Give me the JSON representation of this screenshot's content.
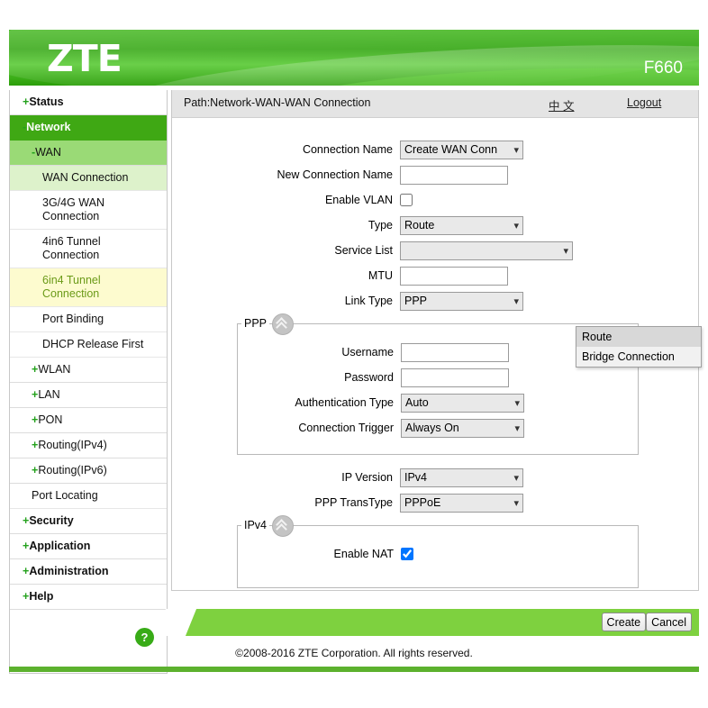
{
  "header": {
    "brand": "ZTE",
    "model": "F660"
  },
  "pathbar": {
    "path": "Path:Network-WAN-WAN Connection",
    "language_label": "中 文",
    "logout_label": "Logout"
  },
  "sidebar": {
    "items": [
      {
        "label": "Status",
        "prefix": "+",
        "level": "top",
        "state": "normal"
      },
      {
        "label": "Network",
        "prefix": "-",
        "level": "top",
        "state": "active"
      },
      {
        "label": "WAN",
        "prefix": "-",
        "level": "sub",
        "state": "open"
      },
      {
        "label": "WAN Connection",
        "prefix": "",
        "level": "leaf",
        "state": "selected"
      },
      {
        "label": "3G/4G WAN Connection",
        "prefix": "",
        "level": "leaf",
        "state": "normal"
      },
      {
        "label": "4in6 Tunnel Connection",
        "prefix": "",
        "level": "leaf",
        "state": "normal"
      },
      {
        "label": "6in4 Tunnel Connection",
        "prefix": "",
        "level": "leaf",
        "state": "hovered"
      },
      {
        "label": "Port Binding",
        "prefix": "",
        "level": "leaf",
        "state": "normal"
      },
      {
        "label": "DHCP Release First",
        "prefix": "",
        "level": "leaf",
        "state": "normal"
      },
      {
        "label": "WLAN",
        "prefix": "+",
        "level": "sub",
        "state": "normal"
      },
      {
        "label": "LAN",
        "prefix": "+",
        "level": "sub",
        "state": "normal"
      },
      {
        "label": "PON",
        "prefix": "+",
        "level": "sub",
        "state": "normal"
      },
      {
        "label": "Routing(IPv4)",
        "prefix": "+",
        "level": "sub",
        "state": "normal"
      },
      {
        "label": "Routing(IPv6)",
        "prefix": "+",
        "level": "sub",
        "state": "normal"
      },
      {
        "label": "Port Locating",
        "prefix": "",
        "level": "sub-plain",
        "state": "normal"
      },
      {
        "label": "Security",
        "prefix": "+",
        "level": "top",
        "state": "normal"
      },
      {
        "label": "Application",
        "prefix": "+",
        "level": "top",
        "state": "normal"
      },
      {
        "label": "Administration",
        "prefix": "+",
        "level": "top",
        "state": "normal"
      },
      {
        "label": "Help",
        "prefix": "+",
        "level": "top",
        "state": "normal"
      }
    ],
    "help_icon_label": "?"
  },
  "form": {
    "connection_name": {
      "label": "Connection Name",
      "value": "Create WAN Conn",
      "options": [
        "Create WAN Connection"
      ]
    },
    "new_connection_name": {
      "label": "New Connection Name",
      "value": "",
      "placeholder": ""
    },
    "enable_vlan": {
      "label": "Enable VLAN",
      "checked": false
    },
    "type": {
      "label": "Type",
      "value": "Route",
      "options": [
        "Route",
        "Bridge Connection"
      ],
      "expanded": true,
      "highlighted_option": "Route"
    },
    "service_list": {
      "label": "Service List",
      "value": "",
      "options": []
    },
    "mtu": {
      "label": "MTU",
      "value": ""
    },
    "link_type": {
      "label": "Link Type",
      "value": "PPP",
      "options": [
        "PPP"
      ]
    },
    "ppp_panel": {
      "title": "PPP",
      "collapse_icon": "chevron-double-up",
      "username": {
        "label": "Username",
        "value": ""
      },
      "password": {
        "label": "Password",
        "value": ""
      },
      "authentication_type": {
        "label": "Authentication Type",
        "value": "Auto",
        "options": [
          "Auto"
        ]
      },
      "connection_trigger": {
        "label": "Connection Trigger",
        "value": "Always On",
        "options": [
          "Always On"
        ]
      }
    },
    "ip_version": {
      "label": "IP Version",
      "value": "IPv4",
      "options": [
        "IPv4"
      ]
    },
    "ppp_transtype": {
      "label": "PPP TransType",
      "value": "PPPoE",
      "options": [
        "PPPoE"
      ]
    },
    "ipv4_panel": {
      "title": "IPv4",
      "collapse_icon": "chevron-double-up",
      "enable_nat": {
        "label": "Enable NAT",
        "checked": true
      }
    }
  },
  "actions": {
    "create_label": "Create",
    "cancel_label": "Cancel"
  },
  "footer": {
    "copyright": "©2008-2016 ZTE Corporation. All rights reserved."
  },
  "colors": {
    "brand_green": "#2ea40c",
    "accent_green": "#7ed13f",
    "active_nav": "#3fa814",
    "hover_yellow": "#fdfbcf",
    "checkbox_blue": "#1277d6"
  }
}
